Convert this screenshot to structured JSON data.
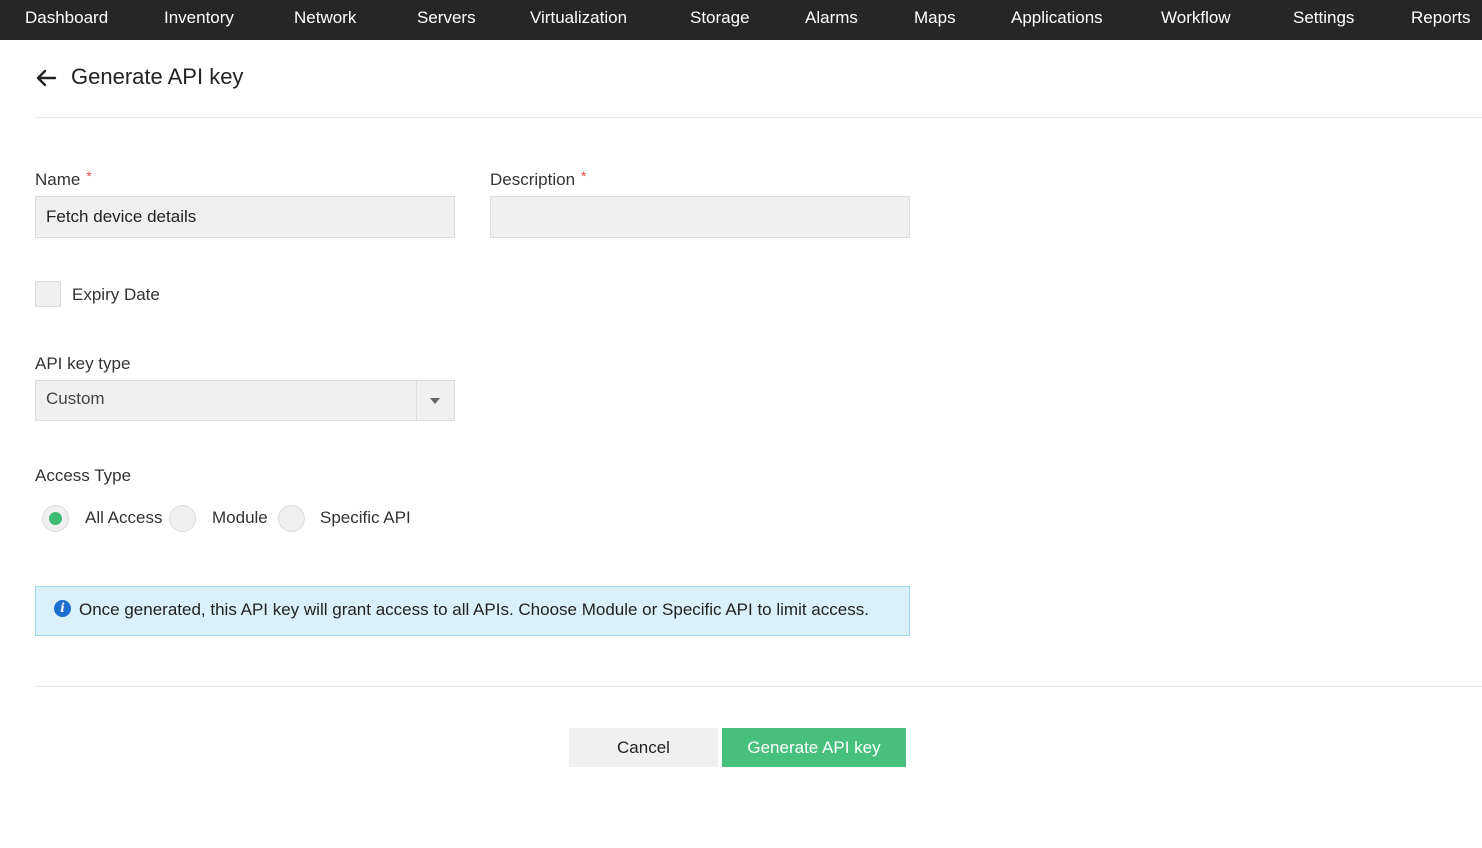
{
  "nav": {
    "items": [
      {
        "label": "Dashboard"
      },
      {
        "label": "Inventory"
      },
      {
        "label": "Network"
      },
      {
        "label": "Servers"
      },
      {
        "label": "Virtualization"
      },
      {
        "label": "Storage"
      },
      {
        "label": "Alarms"
      },
      {
        "label": "Maps"
      },
      {
        "label": "Applications"
      },
      {
        "label": "Workflow"
      },
      {
        "label": "Settings"
      },
      {
        "label": "Reports"
      }
    ]
  },
  "page": {
    "title": "Generate API key",
    "back_icon": "arrow-left-icon"
  },
  "form": {
    "name": {
      "label": "Name",
      "required_mark": "*",
      "value": "Fetch device details"
    },
    "description": {
      "label": "Description",
      "required_mark": "*",
      "value": ""
    },
    "expiry": {
      "label": "Expiry Date",
      "checked": false
    },
    "api_key_type": {
      "label": "API key type",
      "selected": "Custom"
    },
    "access_type": {
      "label": "Access Type",
      "options": [
        {
          "label": "All Access",
          "checked": true
        },
        {
          "label": "Module",
          "checked": false
        },
        {
          "label": "Specific API",
          "checked": false
        }
      ]
    },
    "info": {
      "icon": "info-icon",
      "icon_glyph": "i",
      "text": "Once generated, this API key will grant access to all APIs. Choose Module or Specific API to limit access."
    }
  },
  "actions": {
    "cancel_label": "Cancel",
    "generate_label": "Generate API key"
  },
  "colors": {
    "nav_bg": "#262626",
    "accent_green": "#46c07c",
    "radio_green": "#3dbb74",
    "required_red": "#e04a4a",
    "info_bg": "#daf1fb",
    "info_icon": "#1f6fd0"
  }
}
